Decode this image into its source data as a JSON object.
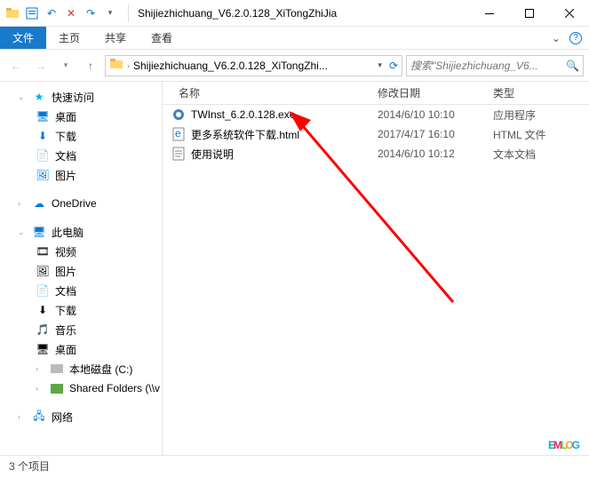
{
  "titlebar": {
    "title": "Shijiezhichuang_V6.2.0.128_XiTongZhiJia"
  },
  "ribbon": {
    "file": "文件",
    "tabs": [
      "主页",
      "共享",
      "查看"
    ]
  },
  "nav": {
    "breadcrumb": "Shijiezhichuang_V6.2.0.128_XiTongZhi...",
    "search_placeholder": "搜索\"Shijiezhichuang_V6..."
  },
  "nav_pane": {
    "quick_access": "快速访问",
    "quick_items": [
      {
        "label": "桌面",
        "icon": "desktop"
      },
      {
        "label": "下载",
        "icon": "downloads"
      },
      {
        "label": "文档",
        "icon": "documents"
      },
      {
        "label": "图片",
        "icon": "pictures"
      }
    ],
    "onedrive": "OneDrive",
    "this_pc": "此电脑",
    "pc_items": [
      {
        "label": "视频",
        "icon": "video"
      },
      {
        "label": "图片",
        "icon": "pictures"
      },
      {
        "label": "文档",
        "icon": "documents"
      },
      {
        "label": "下载",
        "icon": "downloads"
      },
      {
        "label": "音乐",
        "icon": "music"
      },
      {
        "label": "桌面",
        "icon": "desktop"
      },
      {
        "label": "本地磁盘 (C:)",
        "icon": "disk"
      },
      {
        "label": "Shared Folders (\\\\v",
        "icon": "shared"
      }
    ],
    "network": "网络"
  },
  "columns": {
    "name": "名称",
    "modified": "修改日期",
    "type": "类型"
  },
  "files": [
    {
      "name": "TWInst_6.2.0.128.exe",
      "modified": "2014/6/10 10:10",
      "type": "应用程序",
      "icon": "exe"
    },
    {
      "name": "更多系统软件下载.html",
      "modified": "2017/4/17 16:10",
      "type": "HTML 文件",
      "icon": "html"
    },
    {
      "name": "使用说明",
      "modified": "2014/6/10 10:12",
      "type": "文本文档",
      "icon": "txt"
    }
  ],
  "status": {
    "count": "3 个项目"
  },
  "watermark": {
    "e": "E",
    "m": "M",
    "l": "L",
    "o": "O",
    "g": "G"
  }
}
